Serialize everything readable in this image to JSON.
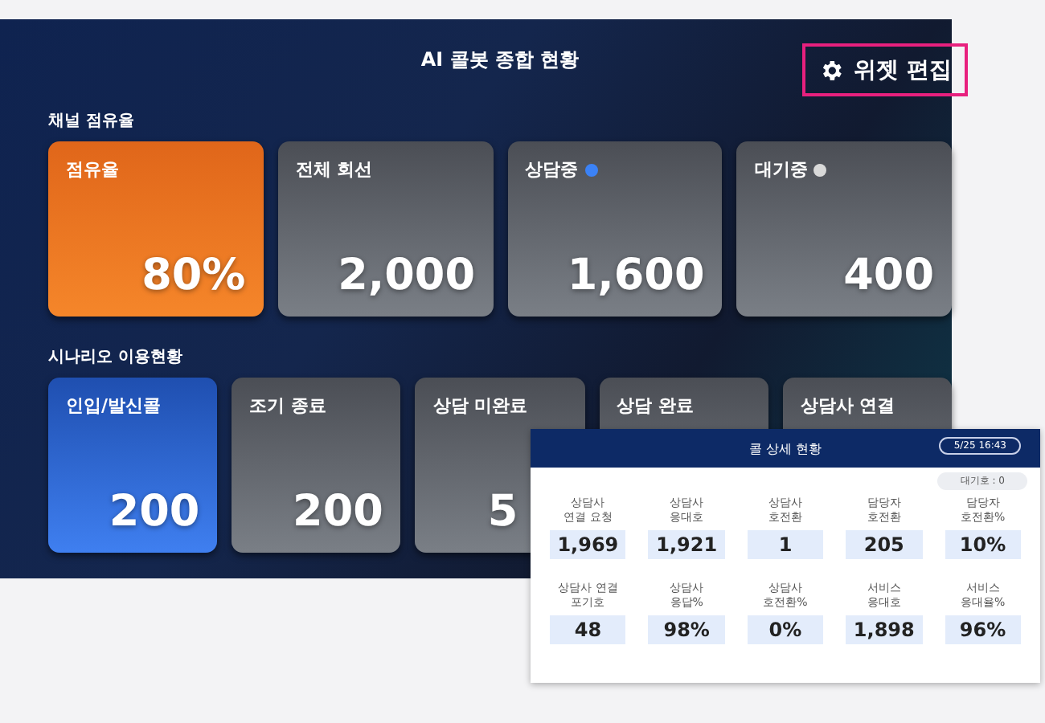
{
  "dashboard": {
    "title": "AI 콜봇 종합 현황",
    "edit_button": "위젯 편집",
    "sections": [
      {
        "title": "채널 점유율",
        "cards": [
          {
            "label": "점유율",
            "value": "80%",
            "kind": "orange"
          },
          {
            "label": "전체 회선",
            "value": "2,000",
            "kind": "gray"
          },
          {
            "label": "상담중",
            "value": "1,600",
            "kind": "gray",
            "color": "#3b82f6"
          },
          {
            "label": "대기중",
            "value": "400",
            "kind": "gray",
            "color": "#d9d9d9"
          }
        ]
      },
      {
        "title": "시나리오 이용현황",
        "cards": [
          {
            "label": "인입/발신콜",
            "value": "200",
            "kind": "blue"
          },
          {
            "label": "조기 종료",
            "value": "200",
            "kind": "gray"
          },
          {
            "label": "상담 미완료",
            "value": "5",
            "kind": "gray",
            "cut": true
          },
          {
            "label": "상담 완료",
            "kind": "gray"
          },
          {
            "label": "상담사 연결",
            "kind": "gray"
          }
        ]
      }
    ]
  },
  "detail_panel": {
    "title": "콜 상세 현황",
    "time": "5/25 16:43",
    "waiting": "대기호 : 0",
    "stats": [
      {
        "label": "상담사\n연결 요청",
        "value": "1,969"
      },
      {
        "label": "상담사\n응대호",
        "value": "1,921"
      },
      {
        "label": "상담사\n호전환",
        "value": "1"
      },
      {
        "label": "담당자\n호전환",
        "value": "205"
      },
      {
        "label": "담당자\n호전환%",
        "value": "10%"
      },
      {
        "label": "상담사 연결\n포기호",
        "value": "48"
      },
      {
        "label": "상담사\n응답%",
        "value": "98%"
      },
      {
        "label": "상담사\n호전환%",
        "value": "0%"
      },
      {
        "label": "서비스\n응대호",
        "value": "1,898"
      },
      {
        "label": "서비스\n응대율%",
        "value": "96%"
      }
    ]
  }
}
